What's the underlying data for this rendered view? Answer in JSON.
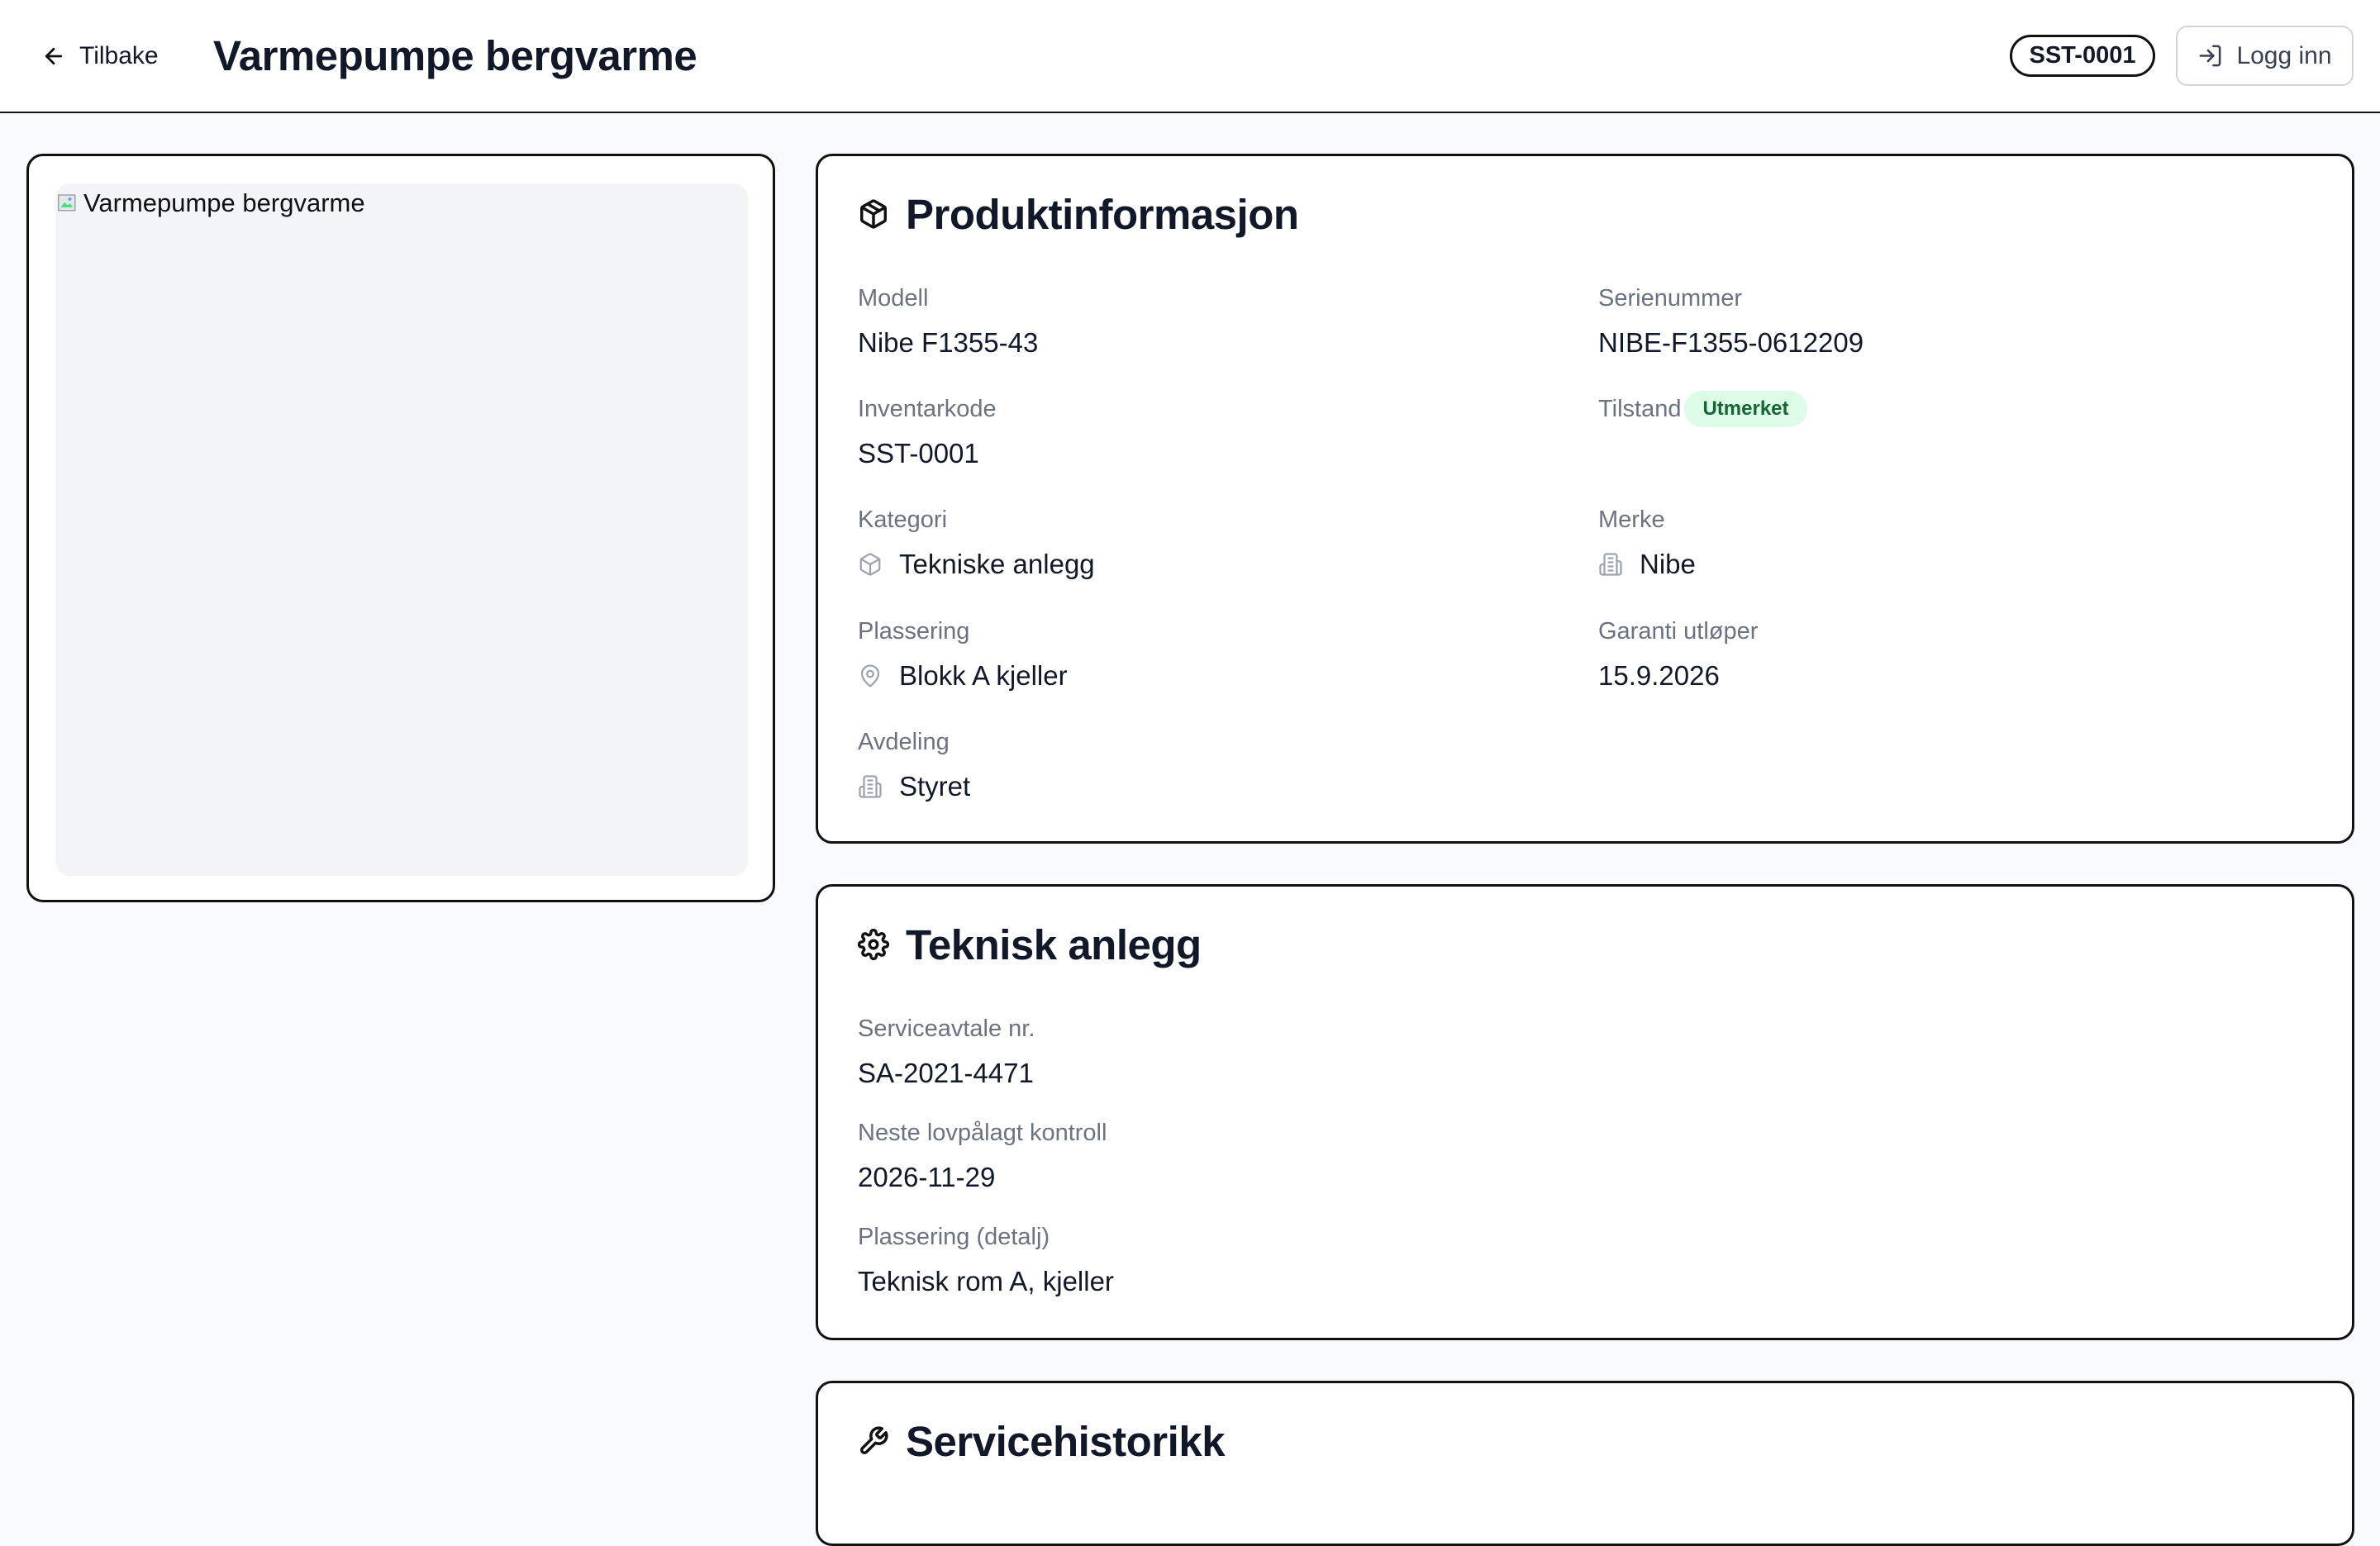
{
  "header": {
    "back_label": "Tilbake",
    "title": "Varmepumpe bergvarme",
    "code_badge": "SST-0001",
    "login_label": "Logg inn"
  },
  "image": {
    "alt": "Varmepumpe bergvarme"
  },
  "product_info": {
    "title": "Produktinformasjon",
    "model_label": "Modell",
    "model_value": "Nibe F1355-43",
    "serial_label": "Serienummer",
    "serial_value": "NIBE-F1355-0612209",
    "inventory_label": "Inventarkode",
    "inventory_value": "SST-0001",
    "condition_label": "Tilstand",
    "condition_value": "Utmerket",
    "category_label": "Kategori",
    "category_value": "Tekniske anlegg",
    "brand_label": "Merke",
    "brand_value": "Nibe",
    "location_label": "Plassering",
    "location_value": "Blokk A kjeller",
    "warranty_label": "Garanti utløper",
    "warranty_value": "15.9.2026",
    "department_label": "Avdeling",
    "department_value": "Styret"
  },
  "technical": {
    "title": "Teknisk anlegg",
    "service_agreement_label": "Serviceavtale nr.",
    "service_agreement_value": "SA-2021-4471",
    "next_inspection_label": "Neste lovpålagt kontroll",
    "next_inspection_value": "2026-11-29",
    "location_detail_label": "Plassering (detalj)",
    "location_detail_value": "Teknisk rom A, kjeller"
  },
  "service_history": {
    "title": "Servicehistorikk"
  },
  "colors": {
    "status_bg": "#dcfce7",
    "status_text": "#166534",
    "page_bg": "#f9fafb"
  }
}
